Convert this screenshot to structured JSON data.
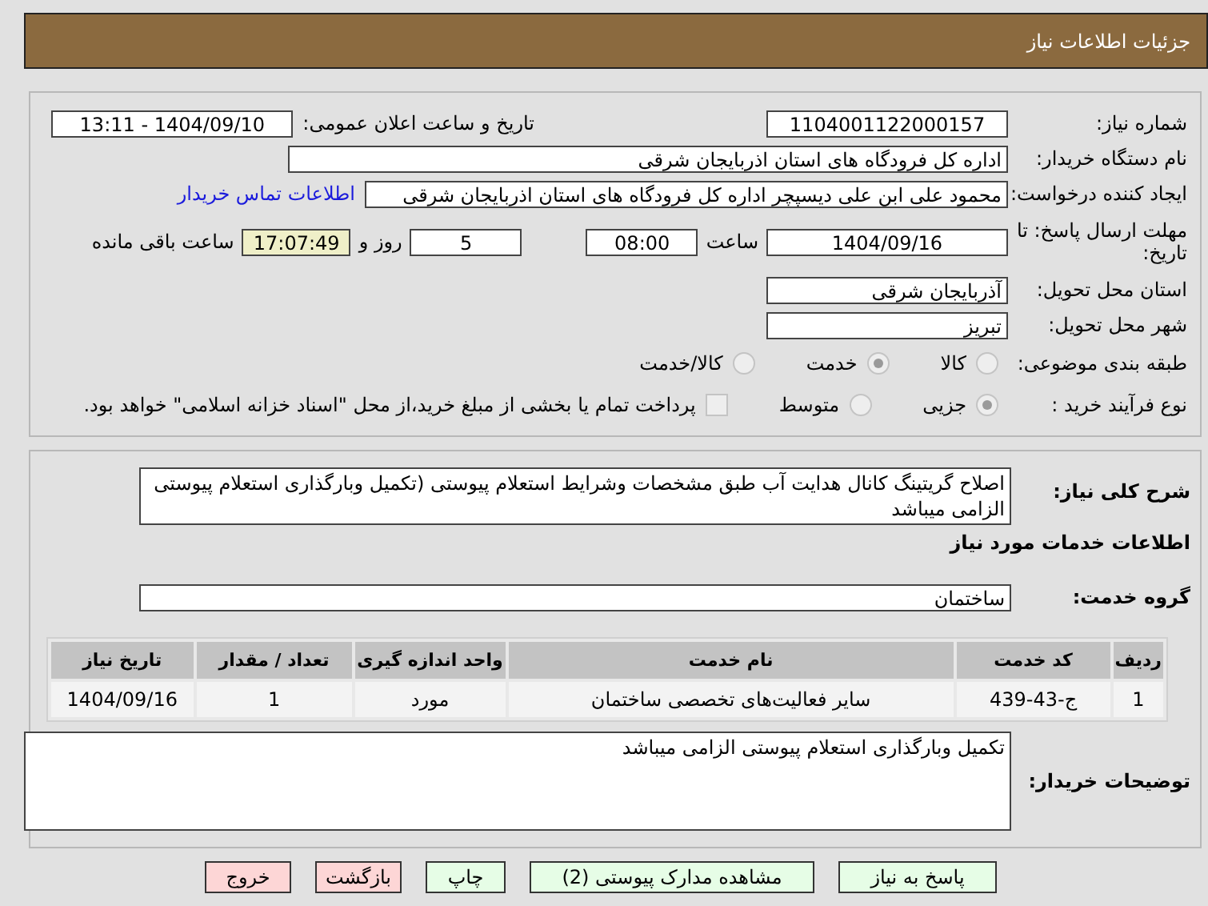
{
  "header": {
    "title": "جزئیات اطلاعات نیاز"
  },
  "details": {
    "need_number": {
      "label": "شماره نیاز:",
      "value": "1104001122000157"
    },
    "announce": {
      "label": "تاریخ و ساعت اعلان عمومی:",
      "value": "1404/09/10 - 13:11"
    },
    "buyer": {
      "label": "نام دستگاه خریدار:",
      "value": "اداره کل فرودگاه های استان اذربایجان شرقی"
    },
    "requester": {
      "label": "ایجاد کننده درخواست:",
      "value": "محمود علی ابن علی دیسپچر اداره کل فرودگاه های استان اذربایجان شرقی",
      "link": "اطلاعات تماس خریدار"
    },
    "deadline": {
      "label": "مهلت ارسال پاسخ: تا تاریخ:",
      "date": "1404/09/16",
      "time_label": "ساعت",
      "time": "08:00",
      "days": "5",
      "days_label": "روز و",
      "remaining": "17:07:49",
      "remaining_label": "ساعت باقی مانده"
    },
    "province": {
      "label": "استان محل تحویل:",
      "value": "آذربایجان شرقی"
    },
    "city": {
      "label": "شهر محل تحویل:",
      "value": "تبریز"
    },
    "category": {
      "label": "طبقه بندی موضوعی:",
      "options": [
        {
          "label": "کالا",
          "selected": false
        },
        {
          "label": "خدمت",
          "selected": true
        },
        {
          "label": "کالا/خدمت",
          "selected": false
        }
      ]
    },
    "purchase_type": {
      "label": "نوع فرآیند خرید :",
      "options": [
        {
          "label": "جزیی",
          "selected": true
        },
        {
          "label": "متوسط",
          "selected": false
        }
      ],
      "payment": {
        "checked": false,
        "text": "پرداخت تمام یا بخشی از مبلغ خرید،از محل \"اسناد خزانه اسلامی\" خواهد بود."
      }
    }
  },
  "need": {
    "summary": {
      "label": "شرح کلی نیاز:",
      "value": "اصلاح گریتینگ کانال هدایت آب طبق مشخصات وشرایط استعلام پیوستی (تکمیل وبارگذاری استعلام پیوستی الزامی میباشد"
    },
    "services_heading": "اطلاعات خدمات مورد نیاز",
    "service_group": {
      "label": "گروه خدمت:",
      "value": "ساختمان"
    },
    "table": {
      "columns": [
        "ردیف",
        "کد خدمت",
        "نام خدمت",
        "واحد اندازه گیری",
        "تعداد / مقدار",
        "تاریخ نیاز"
      ],
      "rows": [
        [
          "1",
          "ج-43-439",
          "سایر فعالیت‌های تخصصی ساختمان",
          "مورد",
          "1",
          "1404/09/16"
        ]
      ]
    },
    "buyer_notes": {
      "label": "توضیحات خریدار:",
      "value": "تکمیل وبارگذاری استعلام پیوستی الزامی میباشد"
    }
  },
  "buttons": [
    {
      "label": "پاسخ به نیاز",
      "kind": "action"
    },
    {
      "label": "مشاهده مدارک پیوستی (2)",
      "kind": "action"
    },
    {
      "label": "چاپ",
      "kind": "action"
    },
    {
      "label": "بازگشت",
      "kind": "exit"
    },
    {
      "label": "خروج",
      "kind": "exit"
    }
  ]
}
